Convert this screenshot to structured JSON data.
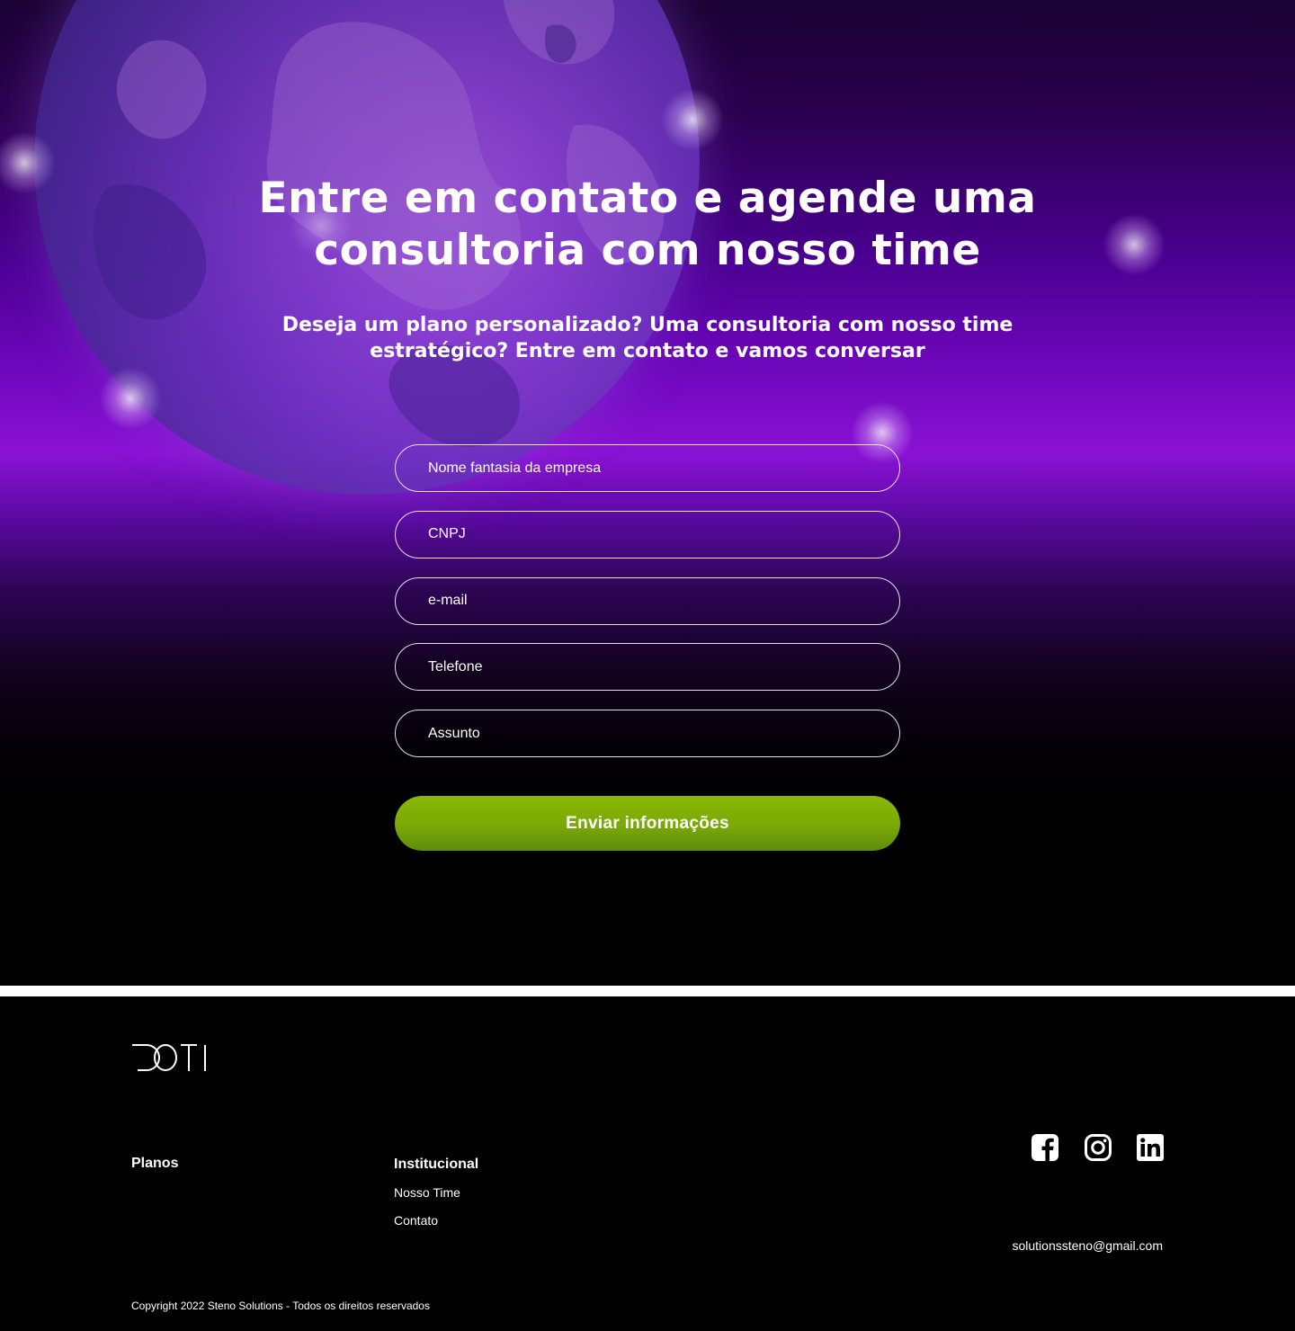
{
  "hero": {
    "title_line1": "Entre em contato e agende uma",
    "title_line2": "consultoria com nosso time",
    "subtitle_line1": "Deseja um plano personalizado? Uma consultoria com nosso time",
    "subtitle_line2": "estratégico? Entre em contato e vamos conversar"
  },
  "form": {
    "fields": [
      {
        "placeholder": "Nome fantasia da empresa"
      },
      {
        "placeholder": "CNPJ"
      },
      {
        "placeholder": "e-mail"
      },
      {
        "placeholder": "Telefone"
      },
      {
        "placeholder": "Assunto"
      }
    ],
    "submit_label": "Enviar informações",
    "submit_color": "#7aa806"
  },
  "footer": {
    "logo_text": "DOTI",
    "columns": [
      {
        "title": "Planos",
        "links": []
      },
      {
        "title": "Institucional",
        "links": [
          "Nosso Time",
          "Contato"
        ]
      }
    ],
    "social_icons": [
      "facebook-icon",
      "instagram-icon",
      "linkedin-icon"
    ],
    "email": "solutionssteno@gmail.com",
    "copyright": "Copyright 2022 Steno Solutions - Todos os direitos reservados"
  },
  "colors": {
    "accent_purple": "#8a12d4",
    "button_green": "#7aa806",
    "background": "#000000"
  }
}
